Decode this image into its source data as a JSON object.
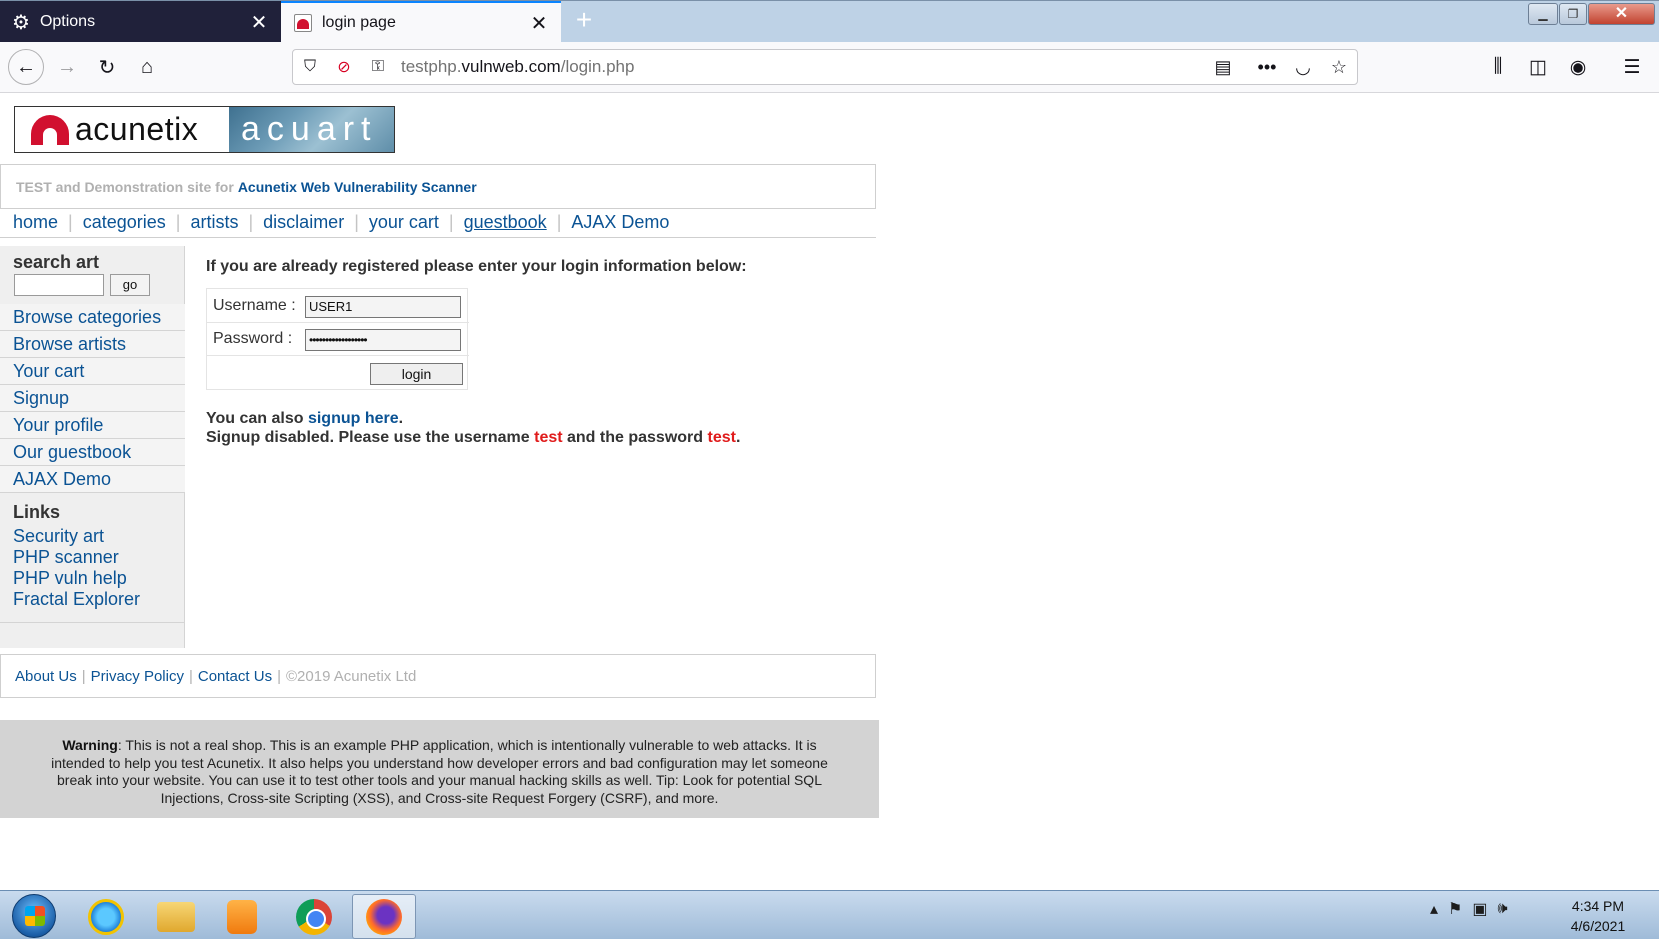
{
  "browser": {
    "tabs": [
      {
        "label": "Options",
        "icon": "gear-icon"
      },
      {
        "label": "login page",
        "icon": "acunetix-favicon"
      }
    ],
    "url": {
      "prefix": "testphp.",
      "domain": "vulnweb.com",
      "path": "/login.php"
    }
  },
  "site": {
    "logo_left": "acunetix",
    "logo_right": "acuart",
    "tagline_prefix": "TEST and Demonstration site for",
    "tagline_link": "Acunetix Web Vulnerability Scanner",
    "nav": [
      "home",
      "categories",
      "artists",
      "disclaimer",
      "your cart",
      "guestbook",
      "AJAX Demo"
    ]
  },
  "sidebar": {
    "search_title": "search art",
    "search_button": "go",
    "items": [
      "Browse categories",
      "Browse artists",
      "Your cart",
      "Signup",
      "Your profile",
      "Our guestbook",
      "AJAX Demo"
    ],
    "links_title": "Links",
    "links": [
      "Security art",
      "PHP scanner",
      "PHP vuln help",
      "Fractal Explorer"
    ]
  },
  "login": {
    "heading": "If you are already registered please enter your login information below:",
    "username_label": "Username :",
    "username_value": "USER1",
    "password_label": "Password :",
    "password_value": "••••••••••••••••••",
    "button": "login",
    "signup_pre": "You can also ",
    "signup_link": "signup here",
    "signup_post": ".",
    "disabled_pre": "Signup disabled. Please use the username ",
    "disabled_user": "test",
    "disabled_mid": " and the password ",
    "disabled_pass": "test",
    "disabled_post": "."
  },
  "footer": {
    "links": [
      "About Us",
      "Privacy Policy",
      "Contact Us"
    ],
    "copyright": "©2019 Acunetix Ltd"
  },
  "warning": {
    "label": "Warning",
    "text": ": This is not a real shop. This is an example PHP application, which is intentionally vulnerable to web attacks. It is intended to help you test Acunetix. It also helps you understand how developer errors and bad configuration may let someone break into your website. You can use it to test other tools and your manual hacking skills as well. Tip: Look for potential SQL Injections, Cross-site Scripting (XSS), and Cross-site Request Forgery (CSRF), and more."
  },
  "taskbar": {
    "time": "4:34 PM",
    "date": "4/6/2021"
  }
}
